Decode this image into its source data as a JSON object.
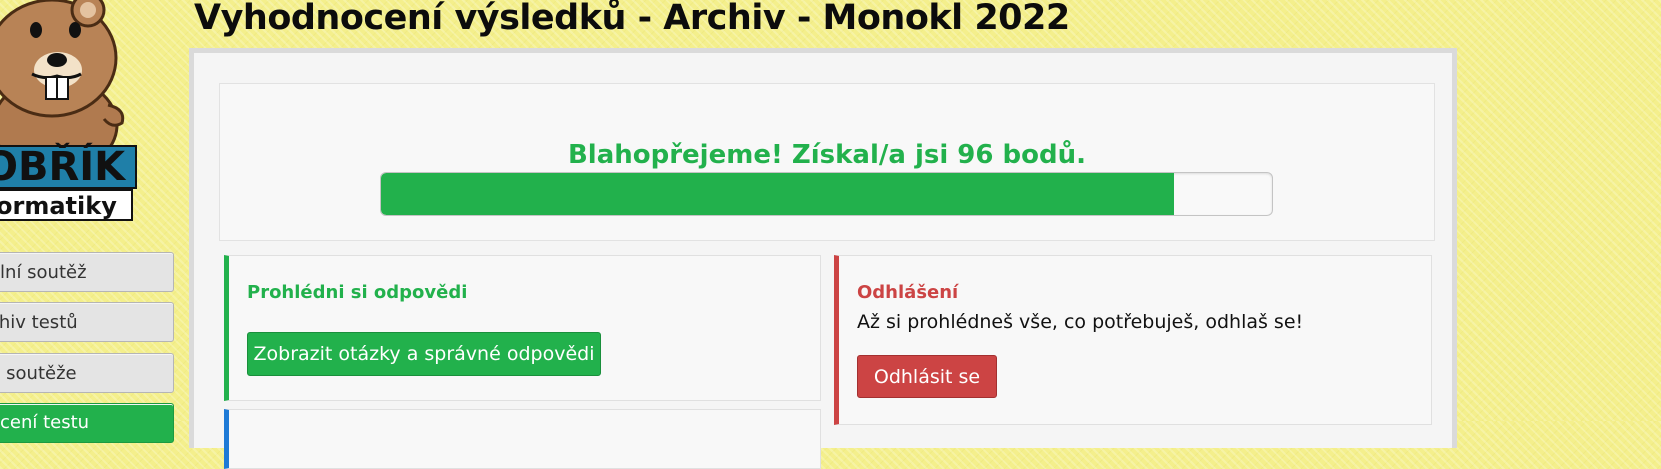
{
  "header": {
    "title": "Vyhodnocení výsledků - Archiv - Monokl 2022"
  },
  "logo": {
    "line1": "OBŘÍK",
    "line2": "ormatiky"
  },
  "sidebar": {
    "items": [
      {
        "label": "ální soutěž"
      },
      {
        "label": "chiv testů"
      },
      {
        "label": "b soutěže"
      },
      {
        "label": "ocení testu"
      }
    ]
  },
  "result": {
    "message": "Blahopřejeme! Získal/a jsi 96 bodů.",
    "progress_fraction": 0.89
  },
  "answers_card": {
    "title": "Prohlédni si odpovědi",
    "button_label": "Zobrazit otázky a správné odpovědi"
  },
  "logout_card": {
    "title": "Odhlášení",
    "text": "Až si prohlédneš vše, co potřebuješ, odhlaš se!",
    "button_label": "Odhlásit se"
  },
  "colors": {
    "success": "#22b14c",
    "danger": "#cc4444",
    "info": "#1e7ad6",
    "background": "#f4ef8c"
  }
}
